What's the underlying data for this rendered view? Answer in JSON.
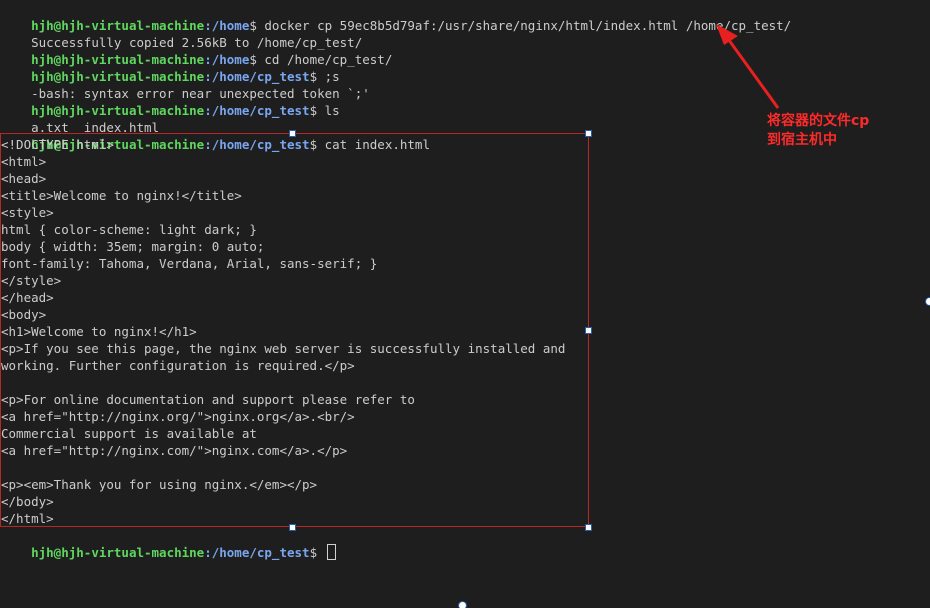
{
  "terminal": {
    "prompt_user": "hjh@hjh-virtual-machine",
    "lines": [
      {
        "kind": "prompt",
        "path": ":/home",
        "cmd": "$ docker cp 59ec8b5d79af:/usr/share/nginx/html/index.html /home/cp_test/"
      },
      {
        "kind": "output",
        "text": "Successfully copied 2.56kB to /home/cp_test/"
      },
      {
        "kind": "prompt",
        "path": ":/home",
        "cmd": "$ cd /home/cp_test/"
      },
      {
        "kind": "prompt",
        "path": ":/home/cp_test",
        "cmd": "$ ;s"
      },
      {
        "kind": "output",
        "text": "-bash: syntax error near unexpected token `;'"
      },
      {
        "kind": "prompt",
        "path": ":/home/cp_test",
        "cmd": "$ ls"
      },
      {
        "kind": "output",
        "text": "a.txt  index.html"
      },
      {
        "kind": "prompt",
        "path": ":/home/cp_test",
        "cmd": "$ cat index.html"
      },
      {
        "kind": "output",
        "text": "<!DOCTYPE html>"
      },
      {
        "kind": "output",
        "text": "<html>"
      },
      {
        "kind": "output",
        "text": "<head>"
      },
      {
        "kind": "output",
        "text": "<title>Welcome to nginx!</title>"
      },
      {
        "kind": "output",
        "text": "<style>"
      },
      {
        "kind": "output",
        "text": "html { color-scheme: light dark; }"
      },
      {
        "kind": "output",
        "text": "body { width: 35em; margin: 0 auto;"
      },
      {
        "kind": "output",
        "text": "font-family: Tahoma, Verdana, Arial, sans-serif; }"
      },
      {
        "kind": "output",
        "text": "</style>"
      },
      {
        "kind": "output",
        "text": "</head>"
      },
      {
        "kind": "output",
        "text": "<body>"
      },
      {
        "kind": "output",
        "text": "<h1>Welcome to nginx!</h1>"
      },
      {
        "kind": "output",
        "text": "<p>If you see this page, the nginx web server is successfully installed and"
      },
      {
        "kind": "output",
        "text": "working. Further configuration is required.</p>"
      },
      {
        "kind": "output",
        "text": ""
      },
      {
        "kind": "output",
        "text": "<p>For online documentation and support please refer to"
      },
      {
        "kind": "output",
        "text": "<a href=\"http://nginx.org/\">nginx.org</a>.<br/>"
      },
      {
        "kind": "output",
        "text": "Commercial support is available at"
      },
      {
        "kind": "output",
        "text": "<a href=\"http://nginx.com/\">nginx.com</a>.</p>"
      },
      {
        "kind": "output",
        "text": ""
      },
      {
        "kind": "output",
        "text": "<p><em>Thank you for using nginx.</em></p>"
      },
      {
        "kind": "output",
        "text": "</body>"
      },
      {
        "kind": "output",
        "text": "</html>"
      },
      {
        "kind": "prompt",
        "path": ":/home/cp_test",
        "cmd": "$ ",
        "cursor": true
      }
    ]
  },
  "annotation": {
    "line1": "将容器的文件cp",
    "line2": "到宿主机中",
    "color": "#ff2a2a"
  }
}
